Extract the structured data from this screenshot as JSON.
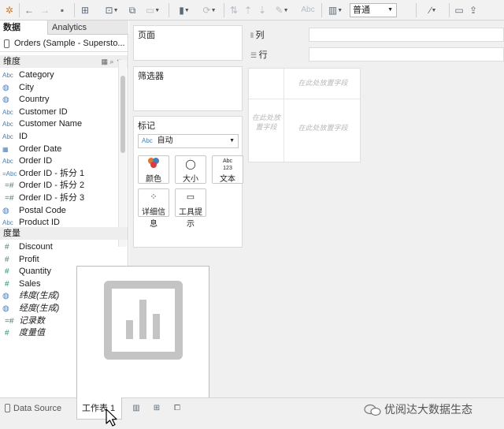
{
  "toolbar": {
    "fit_value": "普通",
    "text_tool_label": "Abc"
  },
  "data_pane": {
    "tabs": [
      {
        "label": "数据"
      },
      {
        "label": "Analytics"
      }
    ],
    "datasource": "Orders (Sample - Supersto...",
    "dimensions_header": "维度",
    "dimensions": [
      {
        "icon": "abc-icon",
        "icon_text": "Abc",
        "name": "Category"
      },
      {
        "icon": "globe-icon",
        "icon_text": "◍",
        "name": "City"
      },
      {
        "icon": "globe-icon",
        "icon_text": "◍",
        "name": "Country"
      },
      {
        "icon": "abc-icon",
        "icon_text": "Abc",
        "name": "Customer ID"
      },
      {
        "icon": "abc-icon",
        "icon_text": "Abc",
        "name": "Customer Name"
      },
      {
        "icon": "abc-icon",
        "icon_text": "Abc",
        "name": "ID"
      },
      {
        "icon": "calendar-icon",
        "icon_text": "▦",
        "name": "Order Date"
      },
      {
        "icon": "abc-icon",
        "icon_text": "Abc",
        "name": "Order ID"
      },
      {
        "icon": "abc-icon",
        "icon_text": "=Abc",
        "name": "Order ID - 拆分 1"
      },
      {
        "icon": "hash-icon",
        "icon_text": "=#",
        "name": "Order ID - 拆分 2"
      },
      {
        "icon": "hash-icon",
        "icon_text": "=#",
        "name": "Order ID - 拆分 3"
      },
      {
        "icon": "globe-icon",
        "icon_text": "◍",
        "name": "Postal Code"
      },
      {
        "icon": "abc-icon",
        "icon_text": "Abc",
        "name": "Product ID"
      }
    ],
    "measures_header": "度量",
    "measures": [
      {
        "icon": "hash-icon",
        "icon_text": "#",
        "name": "Discount"
      },
      {
        "icon": "hash-icon",
        "icon_text": "#",
        "name": "Profit"
      },
      {
        "icon": "hash-icon",
        "icon_text": "#",
        "name": "Quantity"
      },
      {
        "icon": "hash-icon",
        "icon_text": "#",
        "name": "Sales"
      },
      {
        "icon": "globe-icon",
        "icon_text": "◍",
        "name": "纬度(生成)"
      },
      {
        "icon": "globe-icon",
        "icon_text": "◍",
        "name": "经度(生成)"
      },
      {
        "icon": "hash-icon",
        "icon_text": "=#",
        "name": "记录数"
      },
      {
        "icon": "hash-icon",
        "icon_text": "#",
        "name": "度量值"
      }
    ]
  },
  "shelves": {
    "pages_label": "页面",
    "filters_label": "筛选器",
    "marks_label": "标记",
    "marks_type": "自动",
    "marks_type_icon": "Abc",
    "marks_buttons": [
      {
        "name": "color-button",
        "icon": "color-icon",
        "label": "颜色"
      },
      {
        "name": "size-button",
        "icon": "size-icon",
        "label": "大小"
      },
      {
        "name": "text-button",
        "icon": "text-icon",
        "label": "文本"
      },
      {
        "name": "detail-button",
        "icon": "detail-icon",
        "label": "详细信息"
      },
      {
        "name": "tooltip-button",
        "icon": "tooltip-icon",
        "label": "工具提示"
      }
    ],
    "text_icon_top": "Abc",
    "text_icon_bottom": "123",
    "columns_label": "列",
    "rows_label": "行"
  },
  "view": {
    "drop_hint_top": "在此处放置字段",
    "drop_hint_left": "在此处放置字段",
    "drop_hint_center": "在此处放置字段"
  },
  "bottom": {
    "datasource_tab": "Data Source",
    "sheet_tab": "工作表 1",
    "watermark": "优阅达大数据生态"
  }
}
